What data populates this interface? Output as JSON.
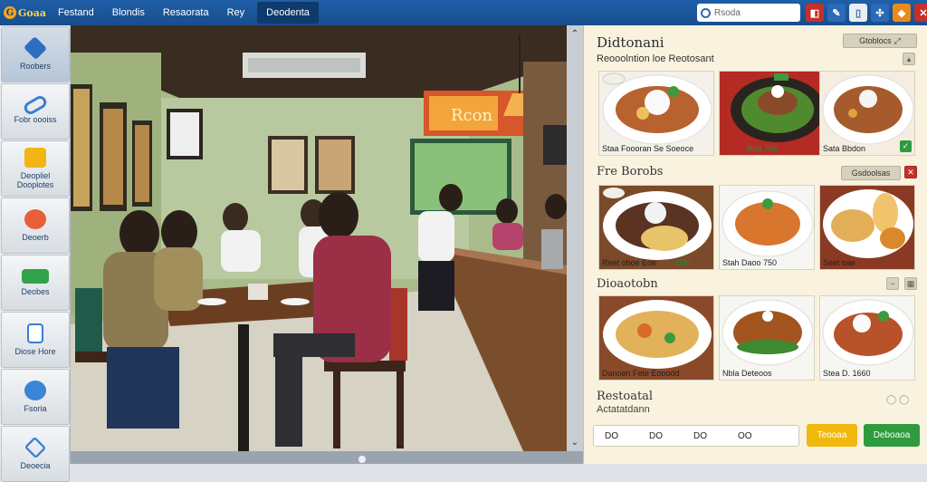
{
  "app": {
    "logo_text": "Goaa",
    "logo_mark": "G"
  },
  "menu": [
    "Festand",
    "Blondis",
    "Resaorata",
    "Rey",
    "Deodenta"
  ],
  "search": {
    "placeholder": "Rsoda"
  },
  "toolbar_icons": [
    {
      "name": "bookmark-icon",
      "glyph": "◧",
      "color": "#c6302c"
    },
    {
      "name": "share-icon",
      "glyph": "✎",
      "color": "#2a6ab8"
    },
    {
      "name": "document-icon",
      "glyph": "▯",
      "color": "#eaeef3"
    },
    {
      "name": "settings-icon",
      "glyph": "✣",
      "color": "#2a6ab8"
    },
    {
      "name": "notification-icon",
      "glyph": "◆",
      "color": "#e98a1c"
    },
    {
      "name": "close-icon",
      "glyph": "✕",
      "color": "#c6302c"
    }
  ],
  "sidebar": [
    {
      "label": "Roobers",
      "color": "#2c6fc2",
      "icon": "cube-icon"
    },
    {
      "label": "Fobr oooiss",
      "color": "#3a7fd0",
      "icon": "link-icon"
    },
    {
      "label": "Deopliel Dooplotes",
      "color": "#f2b515",
      "icon": "box-icon"
    },
    {
      "label": "Deoerb",
      "color": "#e8603a",
      "icon": "food-icon"
    },
    {
      "label": "Deobes",
      "color": "#33a34a",
      "icon": "tray-icon"
    },
    {
      "label": "Diose Hore",
      "color": "#3b7ed6",
      "icon": "page-icon"
    },
    {
      "label": "Fsoria",
      "color": "#3b85d8",
      "icon": "globe-icon"
    },
    {
      "label": "Deoecia",
      "color": "#3b7ed6",
      "icon": "cube-outline-icon"
    }
  ],
  "panel": {
    "title": "Didtonani",
    "subtitle": "Reooolntion loe Reotosant",
    "header_button": "Gtoblocs",
    "section2_title": "Fre Borobs",
    "section2_button": "Gsdoolsas",
    "section3_title": "Dioaotobn",
    "footer_title": "Restoatal",
    "footer_sub": "Actatatdann",
    "footer_icons": "◯ ◯",
    "qty_values": [
      "DO",
      "DO",
      "DO",
      "OO"
    ],
    "btn_secondary": "Teooaa",
    "btn_primary": "Deboaoa"
  },
  "cards": [
    {
      "caption": "Staa Foooran Se Soeoce",
      "price": ""
    },
    {
      "caption": "",
      "price": "Rea 765"
    },
    {
      "caption": "Sata Bbdon",
      "price": ""
    },
    {
      "caption": "Reet oboe Eoe",
      "price": "D3o"
    },
    {
      "caption": "Stah Daoo 750",
      "price": ""
    },
    {
      "caption": "Seet oae",
      "price": ""
    },
    {
      "caption": "Danoen Fete Eooodd",
      "price": ""
    },
    {
      "caption": "Nbla Deteoos",
      "price": ""
    },
    {
      "caption": "Stea D. 1660",
      "price": ""
    }
  ]
}
